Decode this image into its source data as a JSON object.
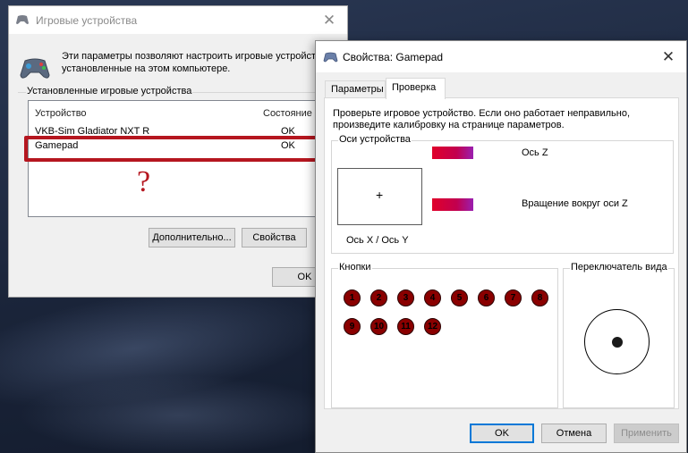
{
  "window1": {
    "title": "Игровые устройства",
    "description": "Эти параметры позволяют настроить игровые устройства, установленные на этом компьютере.",
    "group_label": "Установленные игровые устройства",
    "columns": [
      "Устройство",
      "Состояние"
    ],
    "devices": [
      {
        "name": "VKB-Sim Gladiator NXT R",
        "status": "OK"
      },
      {
        "name": "Gamepad",
        "status": "OK"
      }
    ],
    "annotation": "?",
    "buttons": {
      "advanced": "Дополнительно...",
      "properties": "Свойства",
      "ok": "OK"
    }
  },
  "window2": {
    "title": "Свойства: Gamepad",
    "tabs": [
      "Параметры",
      "Проверка"
    ],
    "active_tab": "Проверка",
    "intro": [
      "Проверьте игровое устройство. Если оно работает неправильно,",
      "произведите калибровку на странице параметров."
    ],
    "axes": {
      "label": "Оси устройства",
      "xy_label": "Ось X / Ось Y",
      "z_label": "Ось Z",
      "rz_label": "Вращение вокруг оси Z"
    },
    "buttons_group": {
      "label": "Кнопки",
      "buttons": [
        "1",
        "2",
        "3",
        "4",
        "5",
        "6",
        "7",
        "8",
        "9",
        "10",
        "11",
        "12"
      ]
    },
    "pov": {
      "label": "Переключатель вида"
    },
    "footer": {
      "ok": "OK",
      "cancel": "Отмена",
      "apply": "Применить"
    }
  },
  "colors": {
    "highlight": "#b5161f",
    "accent": "#0078d7",
    "gamepad_button": "#8a0000"
  }
}
